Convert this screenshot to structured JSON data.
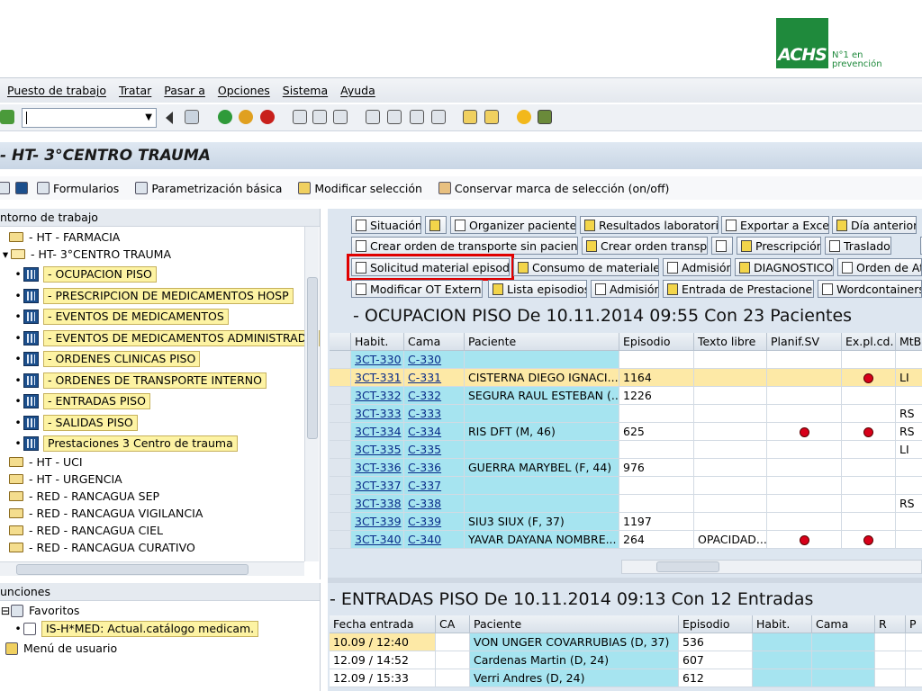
{
  "branding": {
    "logo_text": "ACHS",
    "tag_line1": "N°1 en",
    "tag_line2": "prevención"
  },
  "menubar": [
    "Puesto de trabajo",
    "Tratar",
    "Pasar a",
    "Opciones",
    "Sistema",
    "Ayuda"
  ],
  "command_field": {
    "value": ""
  },
  "window_title": "- HT- 3°CENTRO TRAUMA",
  "app_toolbar": [
    "Formularios",
    "Parametrización básica",
    "Modificar selección",
    "Conservar marca de selección (on/off)"
  ],
  "worklist": {
    "header": "ntorno de trabajo",
    "items": [
      {
        "label": "- HT - FARMACIA",
        "kind": "folder"
      },
      {
        "label": "- HT- 3°CENTRO TRAUMA",
        "kind": "folder-open"
      },
      {
        "label": "- OCUPACION PISO",
        "kind": "view"
      },
      {
        "label": "- PRESCRIPCION DE MEDICAMENTOS HOSP",
        "kind": "view"
      },
      {
        "label": "- EVENTOS DE MEDICAMENTOS",
        "kind": "view"
      },
      {
        "label": "- EVENTOS DE MEDICAMENTOS ADMINISTRADO",
        "kind": "view"
      },
      {
        "label": "- ORDENES CLINICAS PISO",
        "kind": "view"
      },
      {
        "label": "- ORDENES DE TRANSPORTE INTERNO",
        "kind": "view"
      },
      {
        "label": "- ENTRADAS PISO",
        "kind": "view"
      },
      {
        "label": "- SALIDAS PISO",
        "kind": "view"
      },
      {
        "label": "Prestaciones 3 Centro de trauma",
        "kind": "view"
      },
      {
        "label": "- HT - UCI",
        "kind": "folder"
      },
      {
        "label": "- HT - URGENCIA",
        "kind": "folder"
      },
      {
        "label": "- RED - RANCAGUA SEP",
        "kind": "folder"
      },
      {
        "label": "- RED - RANCAGUA VIGILANCIA",
        "kind": "folder"
      },
      {
        "label": "- RED - RANCAGUA CIEL",
        "kind": "folder"
      },
      {
        "label": "- RED - RANCAGUA CURATIVO",
        "kind": "folder"
      }
    ]
  },
  "functions": {
    "header": "unciones",
    "favorites": "Favoritos",
    "favorite_item": "IS-H*MED: Actual.catálogo medicam.",
    "user_menu": "Menú de usuario"
  },
  "buttons_row1": [
    "Situación",
    "",
    "Organizer pacientes",
    "Resultados laboratorio",
    "Exportar a Excel",
    "Día anterior"
  ],
  "buttons_row2": [
    "Crear orden de transporte sin paciente",
    "Crear orden transp.",
    "",
    "Prescripción",
    "Traslado"
  ],
  "buttons_row3": [
    "Solicitud material episodio",
    "Consumo de materiales",
    "Admisión",
    "DIAGNOSTICO",
    "Orden de At"
  ],
  "buttons_row4": [
    "Modificar OT Externa",
    "Lista episodios",
    "Admisión",
    "Entrada de Prestaciones",
    "Wordcontainers"
  ],
  "ocupacion": {
    "title": "- OCUPACION PISO De 10.11.2014 09:55 Con  23 Pacientes",
    "columns": [
      "Habit.",
      "Cama",
      "Paciente",
      "Episodio",
      "Texto libre",
      "Planif.SV",
      "Ex.pl.cd.",
      "MtBl"
    ],
    "rows": [
      {
        "habit": "3CT-330",
        "cama": "C-330",
        "paciente": "",
        "episodio": "",
        "texto": "",
        "planif": false,
        "expl": false,
        "mtbl": ""
      },
      {
        "habit": "3CT-331",
        "cama": "C-331",
        "paciente": "CISTERNA DIEGO IGNACI...",
        "episodio": "1164",
        "texto": "",
        "planif": false,
        "expl": true,
        "mtbl": "LI"
      },
      {
        "habit": "3CT-332",
        "cama": "C-332",
        "paciente": "SEGURA RAUL ESTEBAN (...",
        "episodio": "1226",
        "texto": "",
        "planif": false,
        "expl": false,
        "mtbl": ""
      },
      {
        "habit": "3CT-333",
        "cama": "C-333",
        "paciente": "",
        "episodio": "",
        "texto": "",
        "planif": false,
        "expl": false,
        "mtbl": "RS"
      },
      {
        "habit": "3CT-334",
        "cama": "C-334",
        "paciente": "RIS DFT (M, 46)",
        "episodio": "625",
        "texto": "",
        "planif": true,
        "expl": true,
        "mtbl": "RS"
      },
      {
        "habit": "3CT-335",
        "cama": "C-335",
        "paciente": "",
        "episodio": "",
        "texto": "",
        "planif": false,
        "expl": false,
        "mtbl": "LI"
      },
      {
        "habit": "3CT-336",
        "cama": "C-336",
        "paciente": "GUERRA MARYBEL (F, 44)",
        "episodio": "976",
        "texto": "",
        "planif": false,
        "expl": false,
        "mtbl": ""
      },
      {
        "habit": "3CT-337",
        "cama": "C-337",
        "paciente": "",
        "episodio": "",
        "texto": "",
        "planif": false,
        "expl": false,
        "mtbl": ""
      },
      {
        "habit": "3CT-338",
        "cama": "C-338",
        "paciente": "",
        "episodio": "",
        "texto": "",
        "planif": false,
        "expl": false,
        "mtbl": "RS"
      },
      {
        "habit": "3CT-339",
        "cama": "C-339",
        "paciente": "SIU3 SIUX (F, 37)",
        "episodio": "1197",
        "texto": "",
        "planif": false,
        "expl": false,
        "mtbl": ""
      },
      {
        "habit": "3CT-340",
        "cama": "C-340",
        "paciente": "YAVAR DAYANA NOMBRE...",
        "episodio": "264",
        "texto": "OPACIDAD...",
        "planif": true,
        "expl": true,
        "mtbl": ""
      }
    ]
  },
  "entradas": {
    "title": "- ENTRADAS PISO De 10.11.2014 09:13 Con  12 Entradas",
    "columns": [
      "Fecha entrada",
      "CA",
      "Paciente",
      "Episodio",
      "Habit.",
      "Cama",
      "R",
      "P"
    ],
    "rows": [
      {
        "fecha": "10.09 / 12:40",
        "ca": "",
        "paciente": "VON UNGER COVARRUBIAS (D, 37)",
        "episodio": "536",
        "habit": "",
        "cama": ""
      },
      {
        "fecha": "12.09 / 14:52",
        "ca": "",
        "paciente": "Cardenas Martin (D, 24)",
        "episodio": "607",
        "habit": "",
        "cama": ""
      },
      {
        "fecha": "12.09 / 15:33",
        "ca": "",
        "paciente": "Verri Andres (D, 24)",
        "episodio": "612",
        "habit": "",
        "cama": ""
      }
    ]
  },
  "colors": {
    "accent": "#1f8a3c",
    "row_cyan": "#a6e4f0",
    "row_selected": "#fde9a6",
    "marker_red": "#d8001a",
    "highlight_box": "#e00000"
  }
}
